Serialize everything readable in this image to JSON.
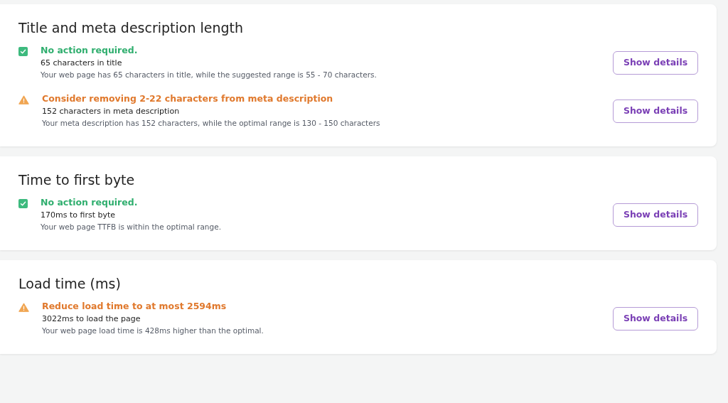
{
  "sections": [
    {
      "title": "Title and meta description length",
      "checks": [
        {
          "kind": "ok",
          "headline": "No action required.",
          "summary": "65 characters in title",
          "detail": "Your web page has 65 characters in title, while the suggested range is 55 - 70 characters.",
          "button": "Show details"
        },
        {
          "kind": "warning",
          "headline": "Consider removing 2-22 characters from meta description",
          "summary": "152 characters in meta description",
          "detail": "Your meta description has 152 characters, while the optimal range is 130 - 150 characters",
          "button": "Show details"
        }
      ]
    },
    {
      "title": "Time to first byte",
      "checks": [
        {
          "kind": "ok",
          "headline": "No action required.",
          "summary": "170ms to first byte",
          "detail": "Your web page TTFB is within the optimal range.",
          "button": "Show details"
        }
      ]
    },
    {
      "title": "Load time (ms)",
      "checks": [
        {
          "kind": "warning",
          "headline": "Reduce load time to at most 2594ms",
          "summary": "3022ms to load the page",
          "detail": "Your web page load time is 428ms higher than the optimal.",
          "button": "Show details"
        }
      ]
    }
  ]
}
